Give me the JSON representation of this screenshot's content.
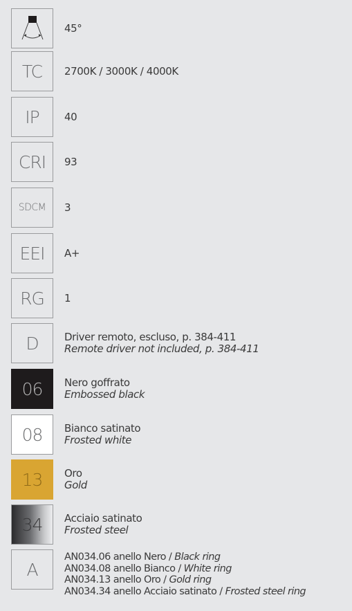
{
  "rows": [
    {
      "box": "",
      "value": "45°"
    },
    {
      "box": "TC",
      "value": "2700K / 3000K / 4000K"
    },
    {
      "box": "IP",
      "value": "40"
    },
    {
      "box": "CRI",
      "value": "93"
    },
    {
      "box": "SDCM",
      "value": "3"
    },
    {
      "box": "EEI",
      "value": "A+"
    },
    {
      "box": "RG",
      "value": "1"
    },
    {
      "box": "D",
      "value": "Driver remoto, escluso, p. 384-411",
      "value_en": "Remote driver not included, p. 384-411"
    }
  ],
  "finishes": [
    {
      "code": "06",
      "it": "Nero goffrato",
      "en": "Embossed black",
      "color": "#1e1b1c"
    },
    {
      "code": "08",
      "it": "Bianco satinato",
      "en": "Frosted white",
      "color": "#ffffff"
    },
    {
      "code": "13",
      "it": "Oro",
      "en": "Gold",
      "color": "#d9a532"
    },
    {
      "code": "34",
      "it": "Acciaio satinato",
      "en": "Frosted steel",
      "color": "#8a8b8d"
    }
  ],
  "accessory": {
    "box": "A",
    "lines": [
      {
        "it": "AN034.06 anello Nero / ",
        "en": "Black ring"
      },
      {
        "it": "AN034.08 anello Bianco / ",
        "en": "White ring"
      },
      {
        "it": "AN034.13 anello Oro / ",
        "en": "Gold ring"
      },
      {
        "it": "AN034.34 anello Acciaio satinato / ",
        "en": "Frosted steel ring"
      }
    ]
  },
  "icons": {
    "beam": "beam-angle-icon"
  }
}
